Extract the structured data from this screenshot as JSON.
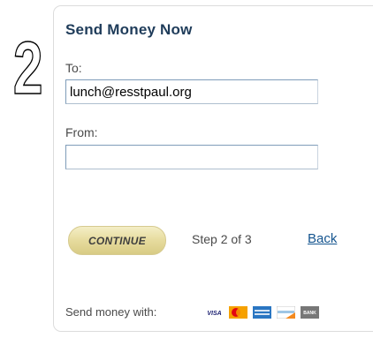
{
  "step_marker": "2",
  "form": {
    "title": "Send Money Now",
    "to_label": "To:",
    "to_value": "lunch@resstpaul.org",
    "from_label": "From:",
    "from_value": ""
  },
  "actions": {
    "continue_label": "CONTINUE",
    "step_text": "Step 2 of 3",
    "back_label": "Back"
  },
  "payment": {
    "label": "Send money with:",
    "methods": [
      {
        "name": "visa-icon",
        "text": "VISA"
      },
      {
        "name": "mastercard-icon",
        "text": ""
      },
      {
        "name": "amex-icon",
        "text": ""
      },
      {
        "name": "discover-icon",
        "text": ""
      },
      {
        "name": "bank-icon",
        "text": "BANK"
      }
    ]
  },
  "colors": {
    "title": "#1f3c5a",
    "link": "#15558f",
    "button_gradient_top": "#f4eec6",
    "button_gradient_bottom": "#d8cb84",
    "input_border": "#7f9db9"
  }
}
